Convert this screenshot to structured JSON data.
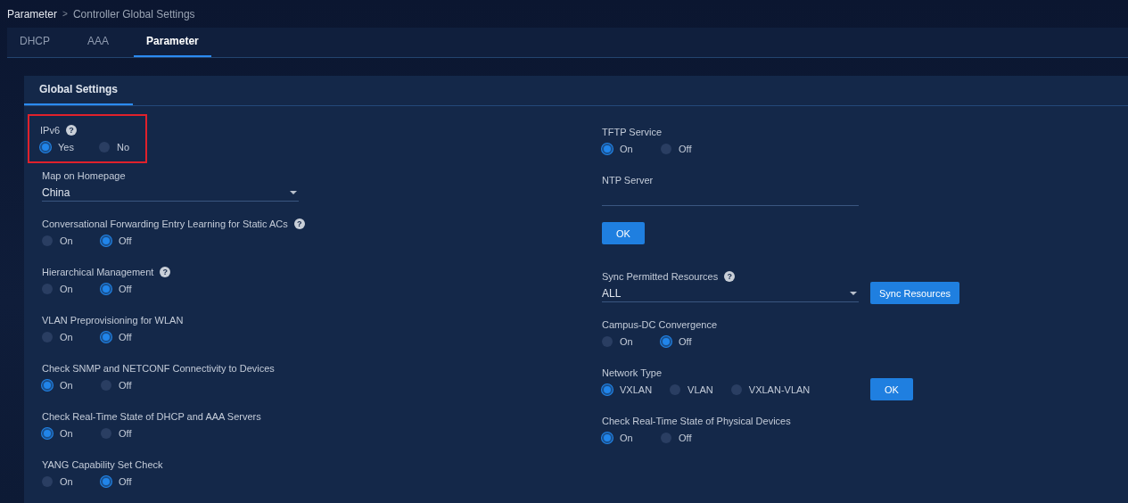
{
  "breadcrumb": {
    "items": [
      "Parameter",
      "Controller Global Settings"
    ],
    "separator": ">"
  },
  "tabs": [
    {
      "label": "DHCP",
      "selected": false
    },
    {
      "label": "AAA",
      "selected": false
    },
    {
      "label": "Parameter",
      "selected": true
    }
  ],
  "panel": {
    "tabs": [
      {
        "label": "Global Settings",
        "selected": true
      }
    ],
    "left": [
      {
        "kind": "radio",
        "label": "IPv6",
        "help": "?",
        "highlighted": true,
        "options": [
          {
            "label": "Yes",
            "selected": true
          },
          {
            "label": "No",
            "selected": false
          }
        ]
      },
      {
        "kind": "select",
        "label": "Map on Homepage",
        "value": "China",
        "highlighted": false
      },
      {
        "kind": "radio",
        "label": "Conversational Forwarding Entry Learning for Static ACs",
        "help": "?",
        "highlighted": false,
        "options": [
          {
            "label": "On",
            "selected": false
          },
          {
            "label": "Off",
            "selected": true
          }
        ]
      },
      {
        "kind": "radio",
        "label": "Hierarchical Management",
        "help": "?",
        "highlighted": false,
        "options": [
          {
            "label": "On",
            "selected": false
          },
          {
            "label": "Off",
            "selected": true
          }
        ]
      },
      {
        "kind": "radio",
        "label": "VLAN Preprovisioning for WLAN",
        "highlighted": false,
        "options": [
          {
            "label": "On",
            "selected": false
          },
          {
            "label": "Off",
            "selected": true
          }
        ]
      },
      {
        "kind": "radio",
        "label": "Check SNMP and NETCONF Connectivity to Devices",
        "highlighted": false,
        "options": [
          {
            "label": "On",
            "selected": true
          },
          {
            "label": "Off",
            "selected": false
          }
        ]
      },
      {
        "kind": "radio",
        "label": "Check Real-Time State of DHCP and AAA Servers",
        "highlighted": false,
        "options": [
          {
            "label": "On",
            "selected": true
          },
          {
            "label": "Off",
            "selected": false
          }
        ]
      },
      {
        "kind": "radio",
        "label": "YANG Capability Set Check",
        "highlighted": false,
        "options": [
          {
            "label": "On",
            "selected": false
          },
          {
            "label": "Off",
            "selected": true
          }
        ]
      }
    ],
    "right": [
      {
        "kind": "radio",
        "label": "TFTP Service",
        "highlighted": false,
        "options": [
          {
            "label": "On",
            "selected": true
          },
          {
            "label": "Off",
            "selected": false
          }
        ]
      },
      {
        "kind": "text",
        "label": "NTP Server",
        "highlighted": false
      },
      {
        "kind": "button",
        "label": "OK",
        "highlighted": false
      },
      {
        "kind": "select",
        "label": "Sync Permitted Resources",
        "help": "?",
        "value": "ALL",
        "button": "Sync Resources",
        "highlighted": false
      },
      {
        "kind": "radio",
        "label": "Campus-DC Convergence",
        "highlighted": false,
        "options": [
          {
            "label": "On",
            "selected": false
          },
          {
            "label": "Off",
            "selected": true
          }
        ]
      },
      {
        "kind": "radio",
        "label": "Network Type",
        "button": "OK",
        "highlighted": false,
        "options": [
          {
            "label": "VXLAN",
            "selected": true
          },
          {
            "label": "VLAN",
            "selected": false
          },
          {
            "label": "VXLAN-VLAN",
            "selected": false
          }
        ]
      },
      {
        "kind": "radio",
        "label": "Check Real-Time State of Physical Devices",
        "highlighted": false,
        "options": [
          {
            "label": "On",
            "selected": true
          },
          {
            "label": "Off",
            "selected": false
          }
        ]
      }
    ]
  }
}
